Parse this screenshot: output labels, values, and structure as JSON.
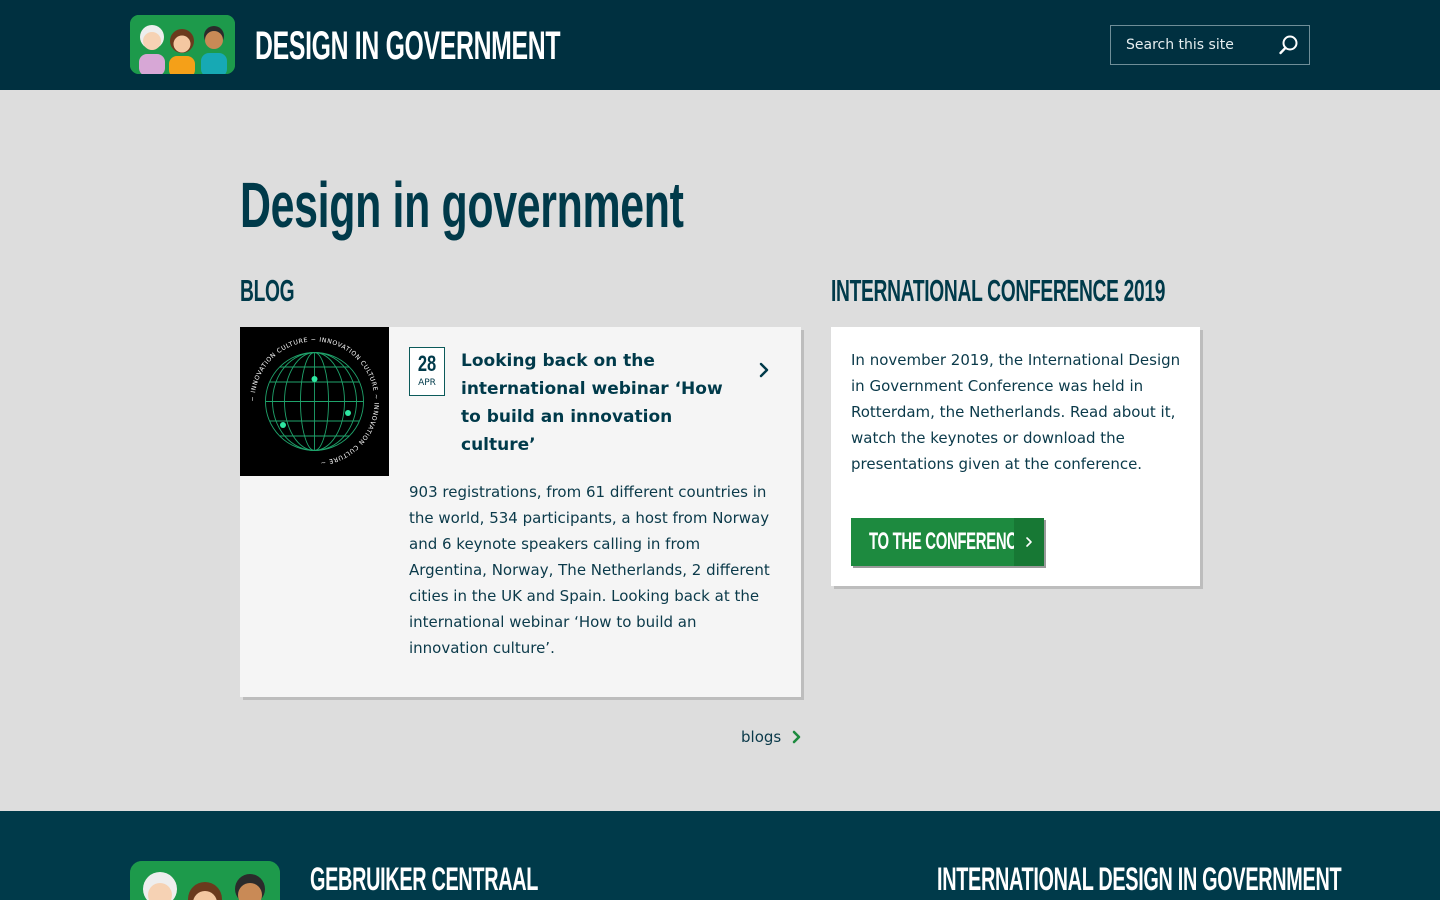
{
  "header": {
    "site_title": "DESIGN IN GOVERNMENT",
    "search_placeholder": "Search this site",
    "logo_icon": "three-people-logo",
    "search_icon": "magnifier-icon"
  },
  "main": {
    "page_title": "Design in government",
    "blog": {
      "heading": "BLOG",
      "post": {
        "day": "28",
        "month": "APR",
        "title": "Looking back on the international webinar ‘How to build an innovation culture’",
        "excerpt": "903 registrations, from 61 different countries in the world, 534 participants, a host from Norway and 6 keynote speakers calling in from Argentina, Norway, The Netherlands, 2 different cities in the UK and Spain. Looking back at the international webinar ‘How to build an innovation culture’.",
        "thumbnail_text": "INNOVATION CULTURE"
      },
      "more_link": "blogs"
    },
    "conference": {
      "heading": "INTERNATIONAL CONFERENCE 2019",
      "text": "In november 2019, the International Design in Government Conference was held in Rotterdam, the Netherlands. Read about it, watch the keynotes or download the presentations given at the conference.",
      "button_label": "TO THE CONFERENCE"
    }
  },
  "footer": {
    "heading_left": "GEBRUIKER CENTRAAL",
    "heading_right": "INTERNATIONAL DESIGN IN GOVERNMENT"
  },
  "colors": {
    "header_bg": "#003040",
    "page_bg": "#dddddd",
    "accent_green": "#1d8a3f",
    "title_teal": "#003a4a"
  }
}
